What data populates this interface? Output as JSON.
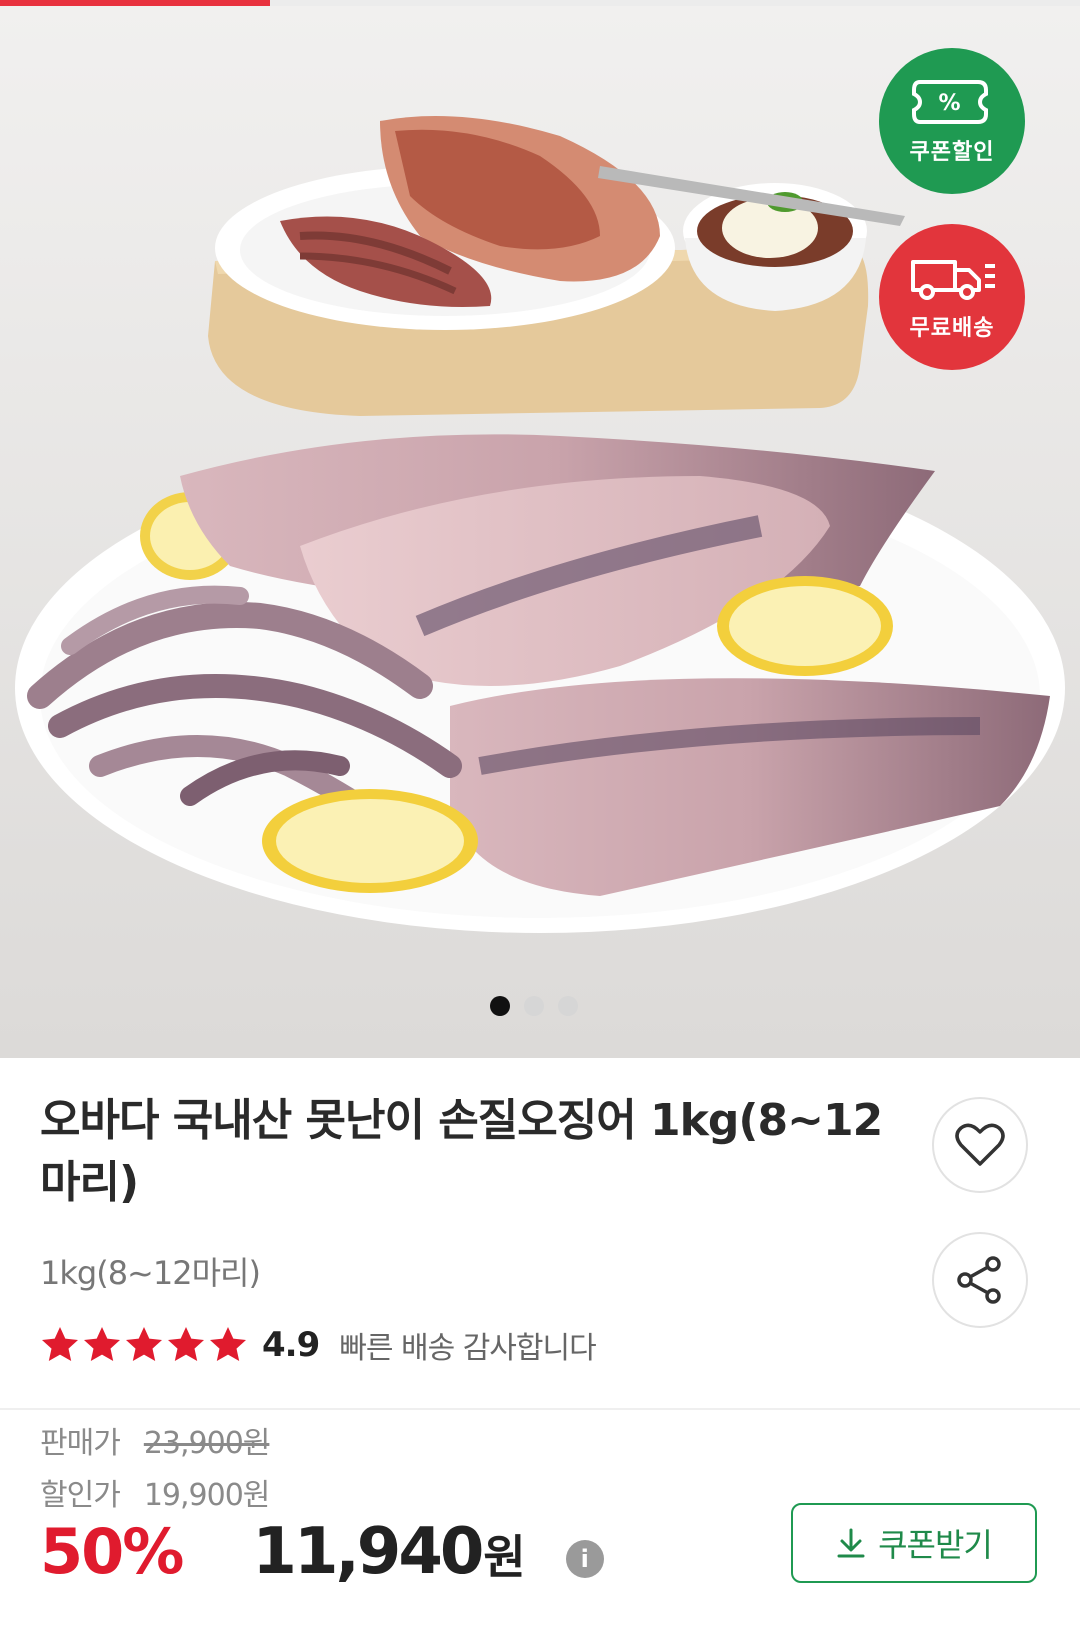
{
  "progress": {
    "fraction": 0.25,
    "color": "#e8323f"
  },
  "badges": {
    "coupon": {
      "label": "쿠폰할인",
      "icon": "percent-coupon-icon",
      "symbol": "%",
      "color": "#1f9a52"
    },
    "shipping": {
      "label": "무료배송",
      "icon": "delivery-truck-icon",
      "color": "#e2353c"
    }
  },
  "carousel": {
    "count": 3,
    "active_index": 0
  },
  "product": {
    "title": "오바다 국내산 못난이 손질오징어 1kg(8~12마리)",
    "option": "1kg(8~12마리)",
    "rating": {
      "stars": 5,
      "score": "4.9",
      "review": "빠른 배송 감사합니다"
    }
  },
  "actions": {
    "wish_icon": "heart-icon",
    "share_icon": "share-icon"
  },
  "price": {
    "original_label": "판매가",
    "original_value": "23,900원",
    "sale_label": "할인가",
    "sale_value": "19,900원",
    "discount_percent": "50%",
    "final_value": "11,940",
    "final_unit": "원",
    "info_icon": "i"
  },
  "coupon_button": {
    "label": "쿠폰받기",
    "icon": "download-arrow-icon"
  },
  "colors": {
    "accent_red": "#e01b2e",
    "accent_green": "#1f9a52"
  }
}
